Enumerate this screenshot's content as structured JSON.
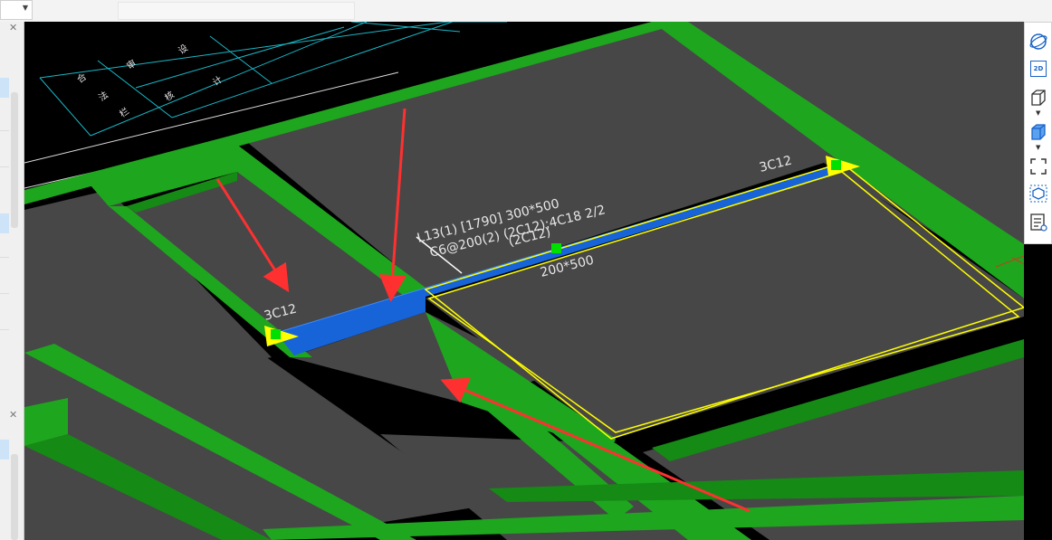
{
  "scene": {
    "beam_label_line1": "L13(1) [1790] 300*500",
    "beam_label_line2": "C6@200(2) (2C12);4C18 2/2",
    "beam_label_line3": "(2C12)",
    "section_label": "200*500",
    "rebar_left": "3C12",
    "rebar_right": "3C12"
  },
  "title_block": {
    "cells": [
      "合",
      "法",
      "栏",
      "审",
      "核",
      "设",
      "计"
    ]
  },
  "toolbar": {
    "buttons": [
      "dynamic-observe",
      "2D",
      "3D view",
      "display mode",
      "fullscreen",
      "section box",
      "layer manager"
    ],
    "badge_2d": "2D"
  },
  "colors": {
    "background": "#000000",
    "slab": "#474747",
    "beam_green": "#1ea61e",
    "beam_green_dark": "#158a15",
    "selected_beam_blue": "#1763d8",
    "highlight_yellow": "#ffff00",
    "arrow_red": "#ff3030",
    "grip_green": "#00e000"
  }
}
